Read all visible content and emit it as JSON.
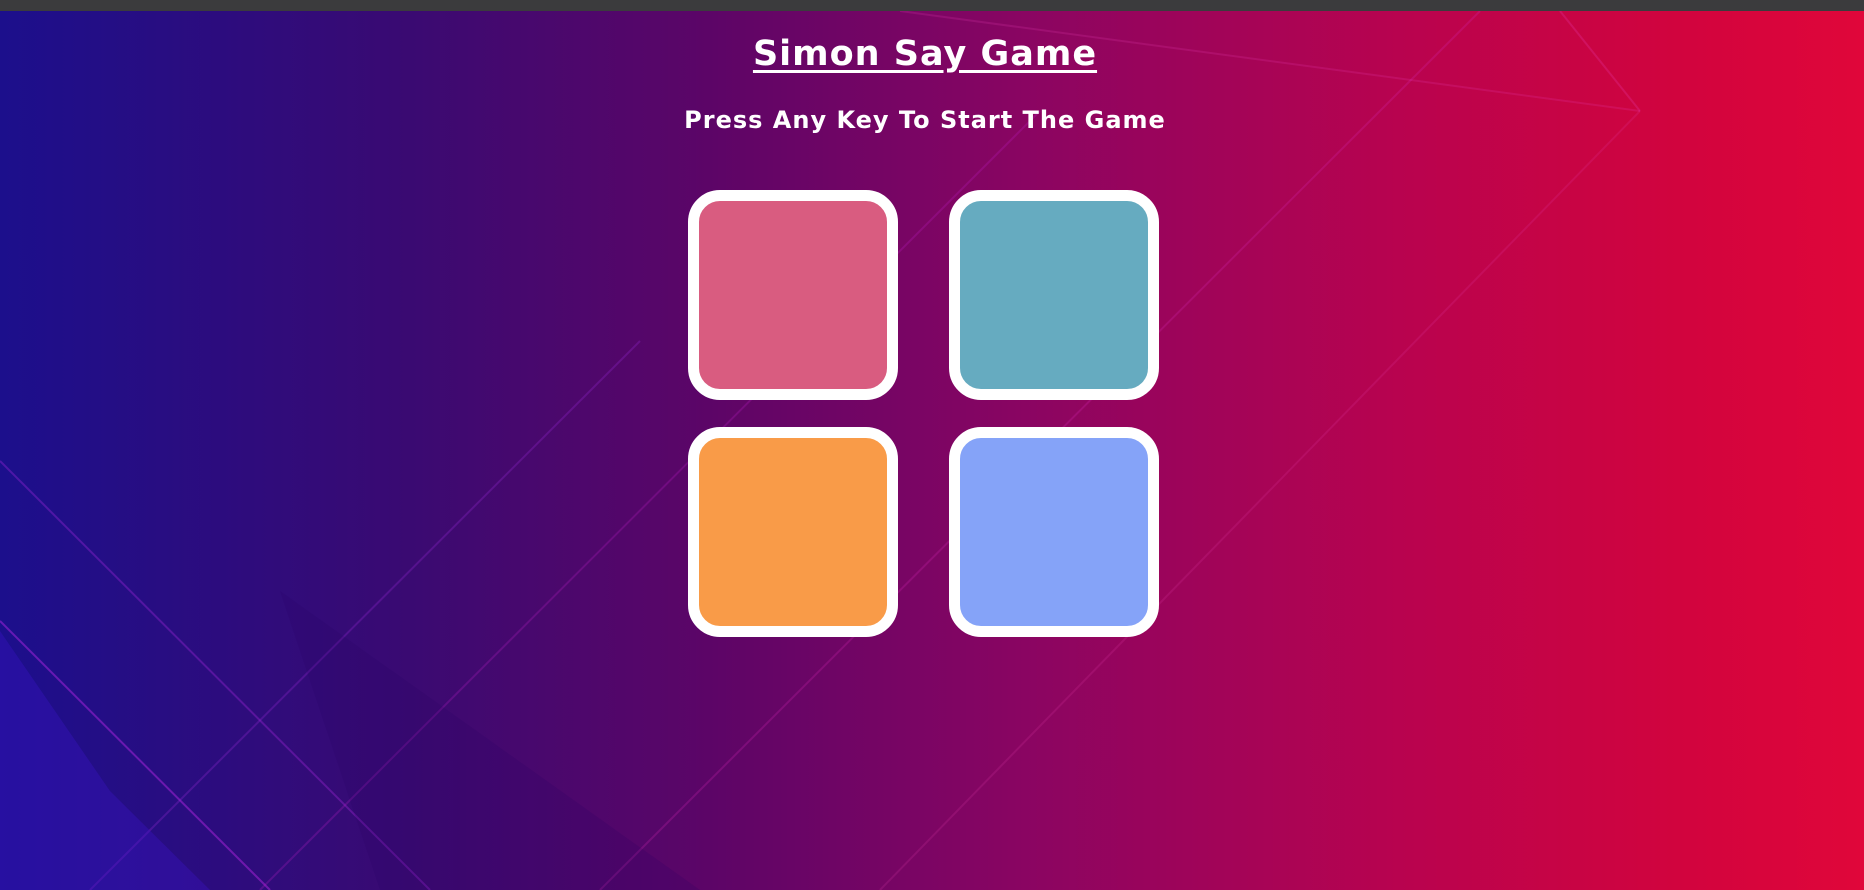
{
  "header": {
    "title": "Simon Say Game",
    "subtitle": "Press Any Key To Start The Game"
  },
  "buttons": [
    {
      "id": "red",
      "color": "#d95c80"
    },
    {
      "id": "teal",
      "color": "#66abc0"
    },
    {
      "id": "orange",
      "color": "#f99b48"
    },
    {
      "id": "blue",
      "color": "#85a3f8"
    }
  ],
  "colors": {
    "topbar": "#3b3b3d",
    "border": "#ffffff",
    "gradient_left": "#1c0f8c",
    "gradient_right": "#e0063a"
  }
}
